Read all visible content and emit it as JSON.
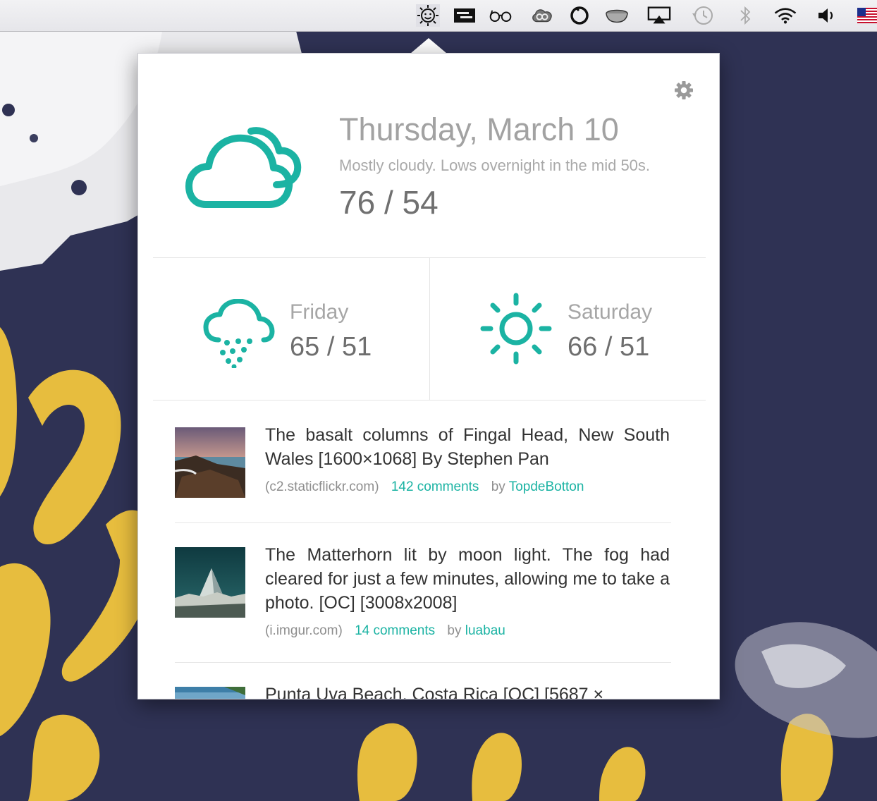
{
  "colors": {
    "accent": "#1bb3a3",
    "menubar": "#ececef",
    "wallpaper": "#2f3254",
    "wallpaper_gold": "#e7bd3e"
  },
  "menubar": {
    "icons": [
      "weather-app-icon",
      "menu-window-icon",
      "glasses-icon",
      "creative-cloud-icon",
      "circle-app-icon",
      "bowl-icon",
      "airplay-icon",
      "time-machine-icon",
      "bluetooth-icon",
      "wifi-icon",
      "volume-icon",
      "us-flag-icon"
    ]
  },
  "today": {
    "date": "Thursday, March 10",
    "summary": "Mostly cloudy. Lows overnight in the mid 50s.",
    "temps": "76 / 54",
    "icon": "cloudy-icon"
  },
  "forecast": [
    {
      "day": "Friday",
      "temps": "65 / 51",
      "icon": "rain-icon"
    },
    {
      "day": "Saturday",
      "temps": "66 / 51",
      "icon": "sun-icon"
    }
  ],
  "news": [
    {
      "title": "The basalt columns of Fingal Head, New South Wales [1600×1068] By Stephen Pan",
      "domain": "(c2.staticflickr.com)",
      "comments": "142 comments",
      "by_label": "by",
      "author": "TopdeBotton"
    },
    {
      "title": "The Matterhorn lit by moon light. The fog had cleared for just a few minutes, allowing me to take a photo. [OC] [3008x2008]",
      "domain": "(i.imgur.com)",
      "comments": "14 comments",
      "by_label": "by",
      "author": "luabau"
    },
    {
      "title": "Punta Uva Beach, Costa Rica [OC] [5687 ×"
    }
  ]
}
